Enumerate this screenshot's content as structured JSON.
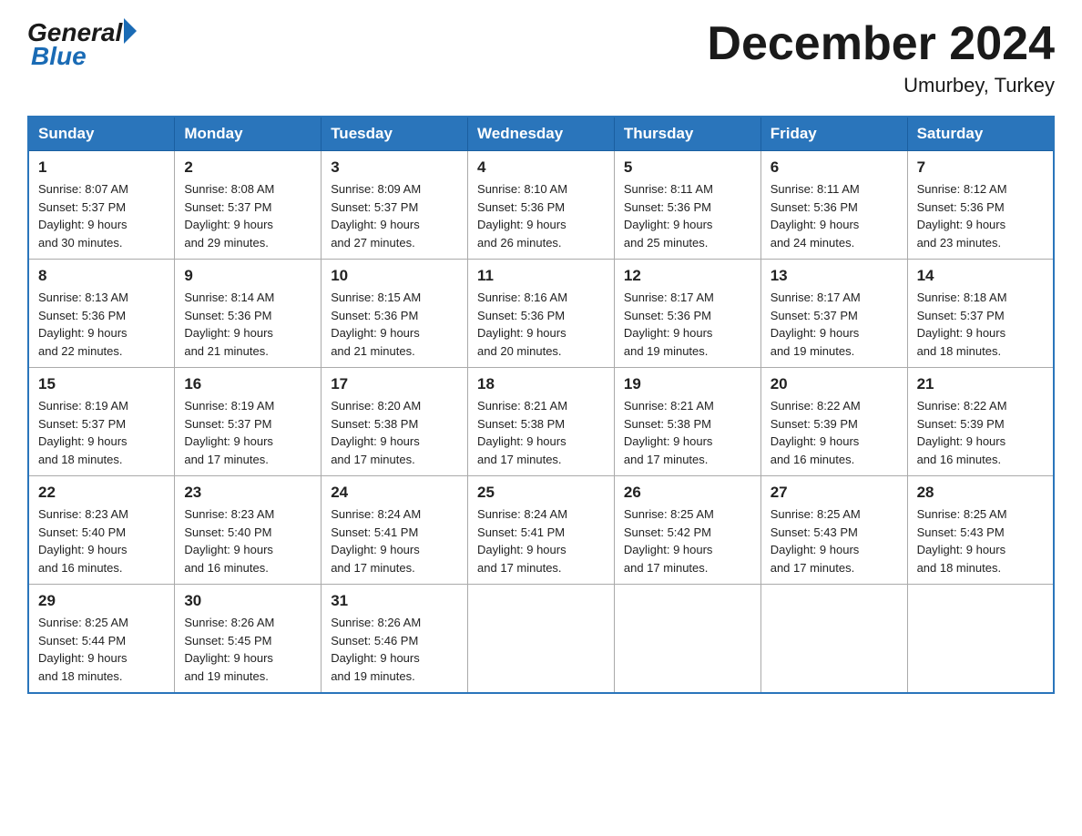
{
  "header": {
    "logo_general": "General",
    "logo_blue": "Blue",
    "month_title": "December 2024",
    "location": "Umurbey, Turkey"
  },
  "days_of_week": [
    "Sunday",
    "Monday",
    "Tuesday",
    "Wednesday",
    "Thursday",
    "Friday",
    "Saturday"
  ],
  "weeks": [
    [
      {
        "day": "1",
        "sunrise": "8:07 AM",
        "sunset": "5:37 PM",
        "daylight": "9 hours and 30 minutes."
      },
      {
        "day": "2",
        "sunrise": "8:08 AM",
        "sunset": "5:37 PM",
        "daylight": "9 hours and 29 minutes."
      },
      {
        "day": "3",
        "sunrise": "8:09 AM",
        "sunset": "5:37 PM",
        "daylight": "9 hours and 27 minutes."
      },
      {
        "day": "4",
        "sunrise": "8:10 AM",
        "sunset": "5:36 PM",
        "daylight": "9 hours and 26 minutes."
      },
      {
        "day": "5",
        "sunrise": "8:11 AM",
        "sunset": "5:36 PM",
        "daylight": "9 hours and 25 minutes."
      },
      {
        "day": "6",
        "sunrise": "8:11 AM",
        "sunset": "5:36 PM",
        "daylight": "9 hours and 24 minutes."
      },
      {
        "day": "7",
        "sunrise": "8:12 AM",
        "sunset": "5:36 PM",
        "daylight": "9 hours and 23 minutes."
      }
    ],
    [
      {
        "day": "8",
        "sunrise": "8:13 AM",
        "sunset": "5:36 PM",
        "daylight": "9 hours and 22 minutes."
      },
      {
        "day": "9",
        "sunrise": "8:14 AM",
        "sunset": "5:36 PM",
        "daylight": "9 hours and 21 minutes."
      },
      {
        "day": "10",
        "sunrise": "8:15 AM",
        "sunset": "5:36 PM",
        "daylight": "9 hours and 21 minutes."
      },
      {
        "day": "11",
        "sunrise": "8:16 AM",
        "sunset": "5:36 PM",
        "daylight": "9 hours and 20 minutes."
      },
      {
        "day": "12",
        "sunrise": "8:17 AM",
        "sunset": "5:36 PM",
        "daylight": "9 hours and 19 minutes."
      },
      {
        "day": "13",
        "sunrise": "8:17 AM",
        "sunset": "5:37 PM",
        "daylight": "9 hours and 19 minutes."
      },
      {
        "day": "14",
        "sunrise": "8:18 AM",
        "sunset": "5:37 PM",
        "daylight": "9 hours and 18 minutes."
      }
    ],
    [
      {
        "day": "15",
        "sunrise": "8:19 AM",
        "sunset": "5:37 PM",
        "daylight": "9 hours and 18 minutes."
      },
      {
        "day": "16",
        "sunrise": "8:19 AM",
        "sunset": "5:37 PM",
        "daylight": "9 hours and 17 minutes."
      },
      {
        "day": "17",
        "sunrise": "8:20 AM",
        "sunset": "5:38 PM",
        "daylight": "9 hours and 17 minutes."
      },
      {
        "day": "18",
        "sunrise": "8:21 AM",
        "sunset": "5:38 PM",
        "daylight": "9 hours and 17 minutes."
      },
      {
        "day": "19",
        "sunrise": "8:21 AM",
        "sunset": "5:38 PM",
        "daylight": "9 hours and 17 minutes."
      },
      {
        "day": "20",
        "sunrise": "8:22 AM",
        "sunset": "5:39 PM",
        "daylight": "9 hours and 16 minutes."
      },
      {
        "day": "21",
        "sunrise": "8:22 AM",
        "sunset": "5:39 PM",
        "daylight": "9 hours and 16 minutes."
      }
    ],
    [
      {
        "day": "22",
        "sunrise": "8:23 AM",
        "sunset": "5:40 PM",
        "daylight": "9 hours and 16 minutes."
      },
      {
        "day": "23",
        "sunrise": "8:23 AM",
        "sunset": "5:40 PM",
        "daylight": "9 hours and 16 minutes."
      },
      {
        "day": "24",
        "sunrise": "8:24 AM",
        "sunset": "5:41 PM",
        "daylight": "9 hours and 17 minutes."
      },
      {
        "day": "25",
        "sunrise": "8:24 AM",
        "sunset": "5:41 PM",
        "daylight": "9 hours and 17 minutes."
      },
      {
        "day": "26",
        "sunrise": "8:25 AM",
        "sunset": "5:42 PM",
        "daylight": "9 hours and 17 minutes."
      },
      {
        "day": "27",
        "sunrise": "8:25 AM",
        "sunset": "5:43 PM",
        "daylight": "9 hours and 17 minutes."
      },
      {
        "day": "28",
        "sunrise": "8:25 AM",
        "sunset": "5:43 PM",
        "daylight": "9 hours and 18 minutes."
      }
    ],
    [
      {
        "day": "29",
        "sunrise": "8:25 AM",
        "sunset": "5:44 PM",
        "daylight": "9 hours and 18 minutes."
      },
      {
        "day": "30",
        "sunrise": "8:26 AM",
        "sunset": "5:45 PM",
        "daylight": "9 hours and 19 minutes."
      },
      {
        "day": "31",
        "sunrise": "8:26 AM",
        "sunset": "5:46 PM",
        "daylight": "9 hours and 19 minutes."
      },
      null,
      null,
      null,
      null
    ]
  ],
  "labels": {
    "sunrise": "Sunrise:",
    "sunset": "Sunset:",
    "daylight": "Daylight:"
  }
}
